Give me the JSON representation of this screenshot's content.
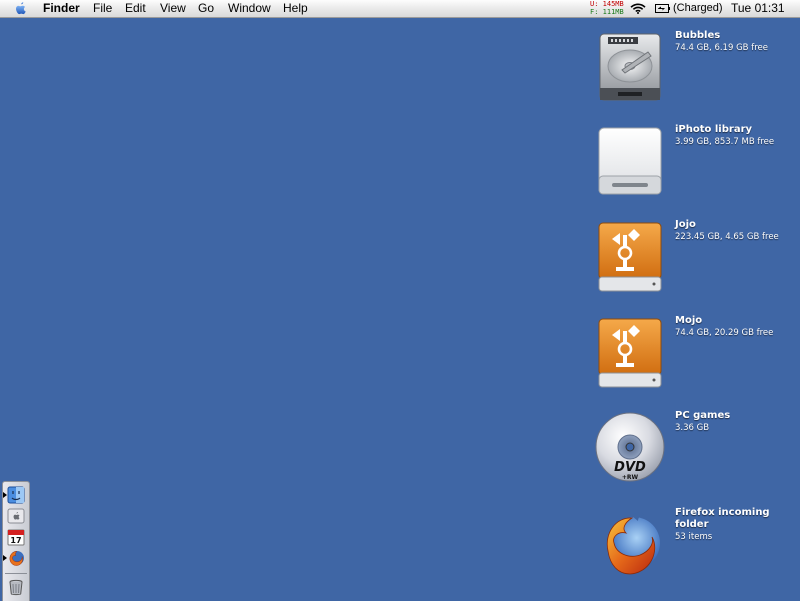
{
  "menubar": {
    "apple_icon": "apple-icon",
    "app_name": "Finder",
    "menus": [
      "File",
      "Edit",
      "View",
      "Go",
      "Window",
      "Help"
    ],
    "memory": {
      "used": "U: 145MB",
      "free": "F: 111MB"
    },
    "wifi_icon": "wifi-icon",
    "battery_icon": "battery-icon",
    "battery_status": "(Charged)",
    "clock": "Tue 01:31"
  },
  "desktop": {
    "icons": [
      {
        "name": "Bubbles",
        "info": "74.4 GB, 6.19 GB free",
        "icon": "hard-drive-icon"
      },
      {
        "name": "iPhoto library",
        "info": "3.99 GB, 853.7 MB free",
        "icon": "external-drive-icon"
      },
      {
        "name": "Jojo",
        "info": "223.45 GB, 4.65 GB free",
        "icon": "firewire-drive-icon"
      },
      {
        "name": "Mojo",
        "info": "74.4 GB, 20.29 GB free",
        "icon": "firewire-drive-icon"
      },
      {
        "name": "PC games",
        "info": "3.36 GB",
        "icon": "dvd-disc-icon"
      },
      {
        "name": "Firefox incoming folder",
        "info": "53 items",
        "icon": "firefox-folder-icon"
      }
    ]
  },
  "dock": {
    "items": [
      "finder-icon",
      "system-preferences-icon",
      "ical-icon",
      "firefox-icon",
      "trash-icon"
    ]
  },
  "colors": {
    "desktop": "#3f66a5",
    "firewire_orange": "#e8891e"
  }
}
